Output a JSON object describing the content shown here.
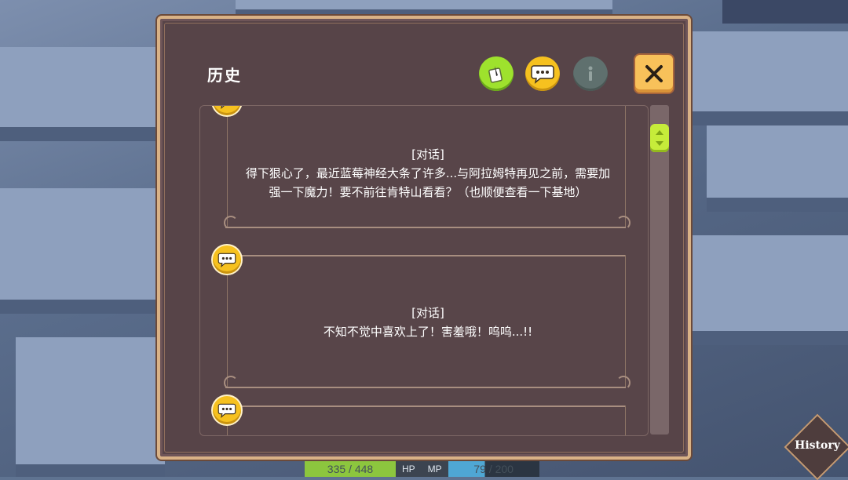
{
  "dialog": {
    "title": "历史",
    "toolbar": {
      "note_icon": "note-quill-icon",
      "chat_icon": "speech-bubble-icon",
      "info_icon": "info-icon",
      "close_icon": "close-x-icon"
    }
  },
  "history_entries": [
    {
      "type_label": "[对话]",
      "lines": [
        "得下狠心了，最近蓝莓神经大条了许多...与阿拉姆特再见之前，需要加",
        "强一下魔力！要不前往肯特山看看？（也顺便查看一下基地）"
      ]
    },
    {
      "type_label": "[对话]",
      "lines": [
        "不知不觉中喜欢上了！害羞哦！呜呜...!!"
      ]
    }
  ],
  "hud": {
    "hp_value": "335 / 448",
    "hp_label": "HP",
    "mp_label": "MP",
    "mp_value": "79 / 200"
  },
  "history_button": {
    "label": "History"
  },
  "colors": {
    "accent_yellow": "#f6c11f",
    "accent_green": "#9ee22d",
    "panel_bg": "#574448",
    "frame": "#d9b286"
  }
}
